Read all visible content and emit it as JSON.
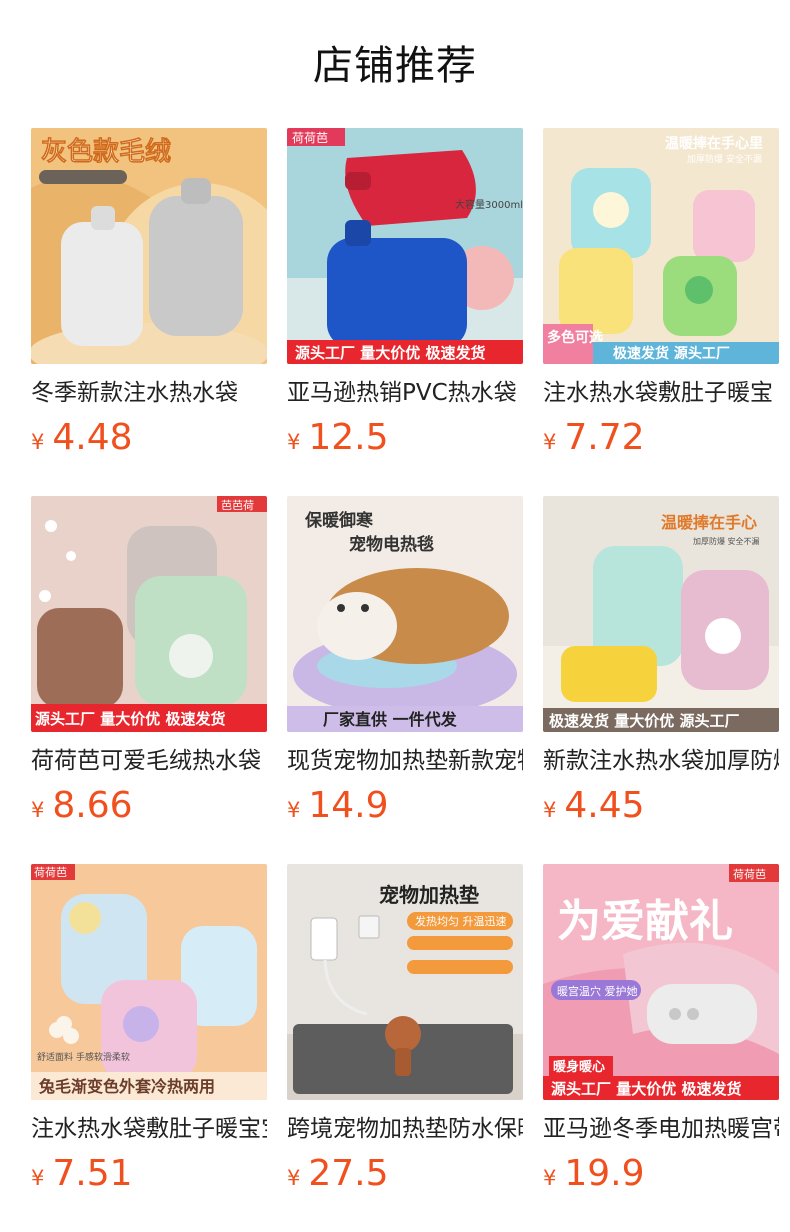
{
  "header": {
    "title": "店铺推荐"
  },
  "products": [
    {
      "name": "冬季新款注水热水袋",
      "currency": "¥",
      "price": "4.48",
      "image": {
        "top_text": "灰色款毛绒",
        "bottom_text": ""
      }
    },
    {
      "name": "亚马逊热销PVC热水袋",
      "currency": "¥",
      "price": "12.5",
      "image": {
        "brand": "荷荷芭",
        "side_text": "大容量3000ml",
        "bottom_text": "源头工厂  量大价优  极速发货"
      }
    },
    {
      "name": "注水热水袋敷肚子暖宝",
      "currency": "¥",
      "price": "7.72",
      "image": {
        "top_text": "温暖捧在手心里",
        "sub_text": "加厚防爆 安全不漏",
        "corner_text": "多色可选",
        "bottom_text": "极速发货  源头工厂"
      }
    },
    {
      "name": "荷荷芭可爱毛绒热水袋",
      "currency": "¥",
      "price": "8.66",
      "image": {
        "brand": "芭芭荷",
        "bottom_text": "源头工厂  量大价优  极速发货"
      }
    },
    {
      "name": "现货宠物加热垫新款宠物",
      "currency": "¥",
      "price": "14.9",
      "image": {
        "top_text": "保暖御寒",
        "sub_text": "宠物电热毯",
        "bottom_text": "厂家直供    一件代发"
      }
    },
    {
      "name": "新款注水热水袋加厚防爆",
      "currency": "¥",
      "price": "4.45",
      "image": {
        "top_text": "温暖捧在手心",
        "sub_text": "加厚防爆 安全不漏",
        "bottom_text": "极速发货   量大价优   源头工厂"
      }
    },
    {
      "name": "注水热水袋敷肚子暖宝宝",
      "currency": "¥",
      "price": "7.51",
      "image": {
        "brand": "荷荷芭",
        "sub_text": "舒适面料 手感软滑柔软",
        "bottom_text": "兔毛渐变色外套冷热两用"
      }
    },
    {
      "name": "跨境宠物加热垫防水保暖",
      "currency": "¥",
      "price": "27.5",
      "image": {
        "top_text": "宠物加热垫",
        "sub_text": "发热均匀 升温迅速",
        "bottom_text": ""
      }
    },
    {
      "name": "亚马逊冬季电加热暖宫带",
      "currency": "¥",
      "price": "19.9",
      "image": {
        "brand": "荷荷芭",
        "top_text": "为爱献礼",
        "sub_text": "暖宫温穴 爱护她",
        "corner_text": "暖身暖心",
        "bottom_text": "源头工厂  量大价优  极速发货"
      }
    }
  ]
}
